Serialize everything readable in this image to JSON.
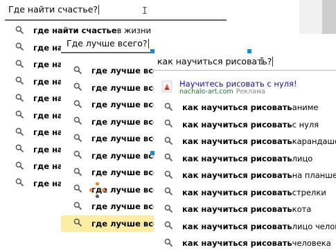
{
  "panel1": {
    "query": "Где найти счастье?",
    "rows": [
      {
        "bold": "где найти счастье",
        "rest": " в жизни"
      },
      {
        "bold": "где на",
        "rest": ""
      },
      {
        "bold": "где на",
        "rest": ""
      },
      {
        "bold": "где на",
        "rest": ""
      },
      {
        "bold": "где на",
        "rest": ""
      },
      {
        "bold": "где на",
        "rest": ""
      },
      {
        "bold": "где на",
        "rest": ""
      },
      {
        "bold": "где на",
        "rest": ""
      },
      {
        "bold": "где на",
        "rest": ""
      },
      {
        "bold": "где на",
        "rest": ""
      }
    ]
  },
  "panel2": {
    "query": "Где лучше всего?",
    "rows": [
      {
        "bold": "где лучше все",
        "rest": ""
      },
      {
        "bold": "где лучше все",
        "rest": ""
      },
      {
        "bold": "где лучше все",
        "rest": ""
      },
      {
        "bold": "где лучше все",
        "rest": ""
      },
      {
        "bold": "где лучше все",
        "rest": ""
      },
      {
        "bold": "где лучше все",
        "rest": ""
      },
      {
        "bold": "где лучше все",
        "rest": ""
      },
      {
        "bold": "где лучше все",
        "rest": ""
      },
      {
        "bold": "где лучше все",
        "rest": ""
      },
      {
        "bold": "где лучше все",
        "rest": ""
      }
    ],
    "selected_index": 9
  },
  "panel3": {
    "query": "как научиться рисовать?",
    "ad": {
      "title": "Научитесь рисовать с нуля!",
      "domain": "nachalo-art.com",
      "label": "Реклама"
    },
    "rows": [
      {
        "bold": "как научиться рисовать",
        "rest": " аниме"
      },
      {
        "bold": "как научиться рисовать",
        "rest": " с нуля"
      },
      {
        "bold": "как научиться рисовать",
        "rest": " карандашом"
      },
      {
        "bold": "как научиться рисовать",
        "rest": " лицо"
      },
      {
        "bold": "как научиться рисовать",
        "rest": " на планшете"
      },
      {
        "bold": "как научиться рисовать",
        "rest": " стрелки"
      },
      {
        "bold": "как научиться рисовать",
        "rest": " кота"
      },
      {
        "bold": "как научиться рисовать",
        "rest": " лицо человека"
      },
      {
        "bold": "как научиться рисовать",
        "rest": " человека"
      }
    ]
  },
  "icons": {
    "suggest": "search-icon",
    "ad_logo": "paintbrush-icon"
  },
  "colors": {
    "selected_bg": "#fbeea2",
    "handle": "#1a8ad6",
    "ad_link": "#1a0dab",
    "ad_domain": "#1a7a2a"
  }
}
